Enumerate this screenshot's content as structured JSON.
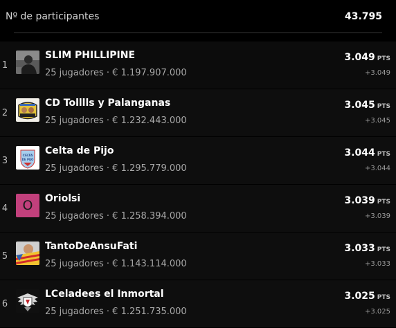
{
  "header": {
    "label": "Nº de participantes",
    "value": "43.795"
  },
  "pts_unit": "PTS",
  "rows": [
    {
      "rank": "1",
      "name": "SLIM PHILLIPINE",
      "meta": "25 jugadores · € 1.197.907.000",
      "points": "3.049",
      "delta": "+3.049",
      "avatar_icon": "player-photo-icon"
    },
    {
      "rank": "2",
      "name": "CD Tolllls y Palanganas",
      "meta": "25 jugadores · € 1.232.443.000",
      "points": "3.045",
      "delta": "+3.045",
      "avatar_icon": "club-crest-icon"
    },
    {
      "rank": "3",
      "name": "Celta de Pijo",
      "meta": "25 jugadores · € 1.295.779.000",
      "points": "3.044",
      "delta": "+3.044",
      "avatar_icon": "celta-badge-icon",
      "avatar_text": "CELTA DE PIJO"
    },
    {
      "rank": "4",
      "name": "Oriolsi",
      "meta": "25 jugadores · € 1.258.394.000",
      "points": "3.039",
      "delta": "+3.039",
      "avatar_icon": "letter-avatar-icon",
      "avatar_letter": "O",
      "avatar_color": "#c2407c"
    },
    {
      "rank": "5",
      "name": "TantoDeAnsuFati",
      "meta": "25 jugadores · € 1.143.114.000",
      "points": "3.033",
      "delta": "+3.033",
      "avatar_icon": "flag-person-icon"
    },
    {
      "rank": "6",
      "name": "LCeladees el Inmortal",
      "meta": "25 jugadores · € 1.251.735.000",
      "points": "3.025",
      "delta": "+3.025",
      "avatar_icon": "winged-emblem-icon"
    }
  ]
}
